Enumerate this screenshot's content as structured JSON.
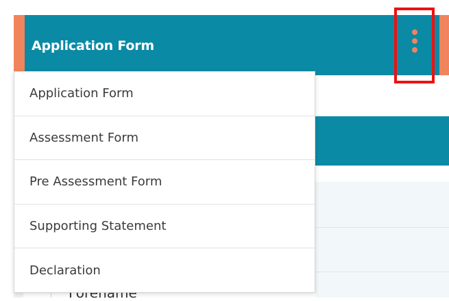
{
  "header": {
    "title": "Application Form",
    "menu_icon": "kebab-menu-icon"
  },
  "menu": {
    "items": [
      {
        "label": "Application Form"
      },
      {
        "label": "Assessment Form"
      },
      {
        "label": "Pre Assessment Form"
      },
      {
        "label": "Supporting Statement"
      },
      {
        "label": "Declaration"
      }
    ]
  },
  "background": {
    "field_label": "Forename"
  },
  "colors": {
    "header_bg": "#0b8aa6",
    "accent": "#f0845c",
    "highlight_box": "#ee1111"
  }
}
